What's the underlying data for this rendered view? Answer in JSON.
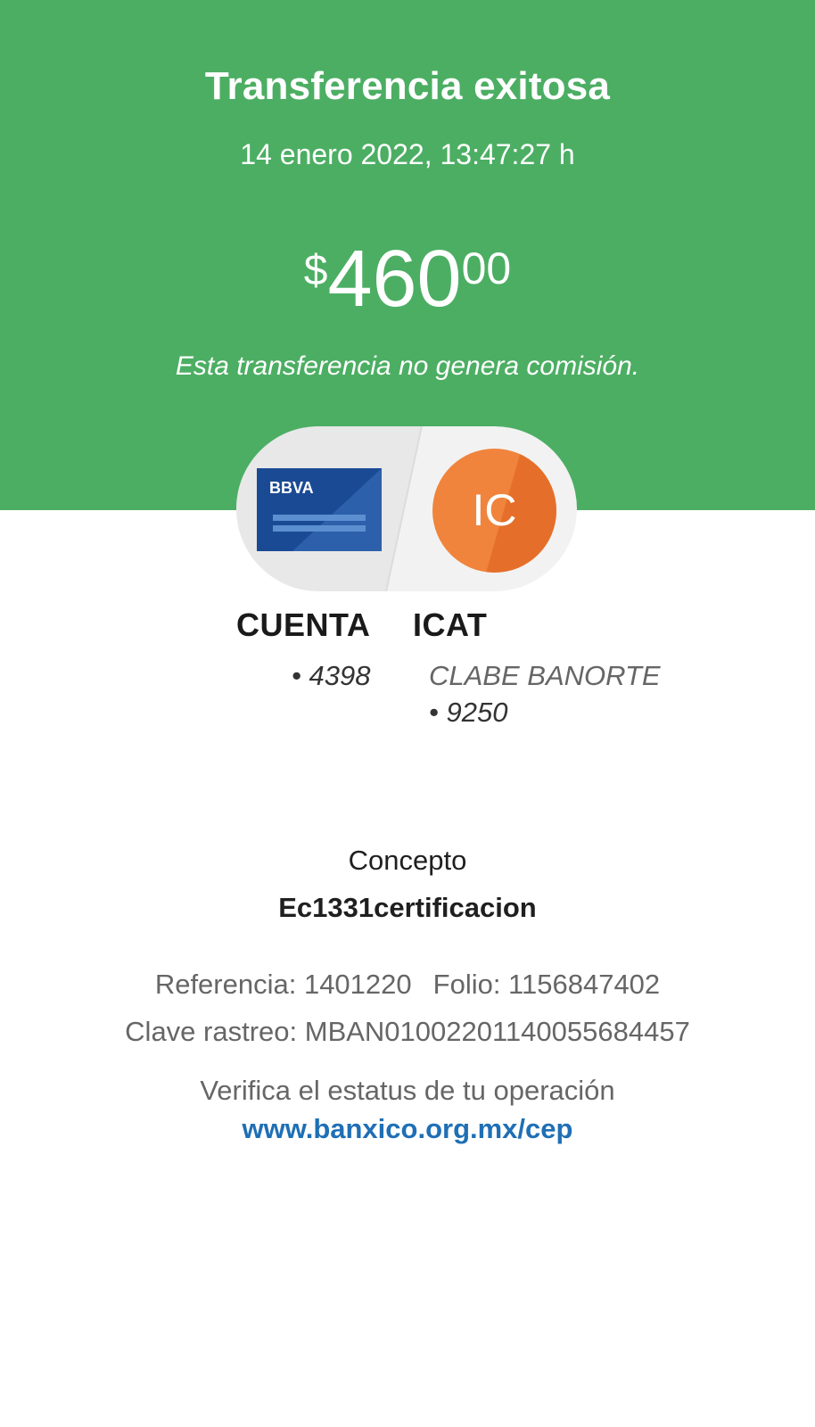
{
  "header": {
    "title": "Transferencia exitosa",
    "datetime": "14 enero 2022, 13:47:27 h"
  },
  "amount": {
    "currency_sign": "$",
    "whole": "460",
    "cents": "00"
  },
  "commission_note": "Esta transferencia no genera comisión.",
  "from_account": {
    "bank_logo_text": "BBVA",
    "title": "CUENTA",
    "number": "• 4398"
  },
  "to_account": {
    "initials": "IC",
    "title": "ICAT",
    "bank_line": "CLABE BANORTE",
    "number": "• 9250"
  },
  "concept": {
    "label": "Concepto",
    "value": "Ec1331certificacion"
  },
  "reference": {
    "referencia": "Referencia: 1401220",
    "folio": "Folio: 1156847402",
    "clave_rastreo": "Clave rastreo: MBAN01002201140055684457"
  },
  "verify": {
    "text": "Verifica el estatus de tu operación",
    "link": "www.banxico.org.mx/cep"
  },
  "colors": {
    "accent_green": "#4cae63",
    "link_blue": "#1f6fb5",
    "bbva_navy": "#1b4a94",
    "avatar_orange": "#f0843c"
  },
  "icons": {
    "bank_card": "bbva-card-icon",
    "avatar": "initials-avatar"
  }
}
